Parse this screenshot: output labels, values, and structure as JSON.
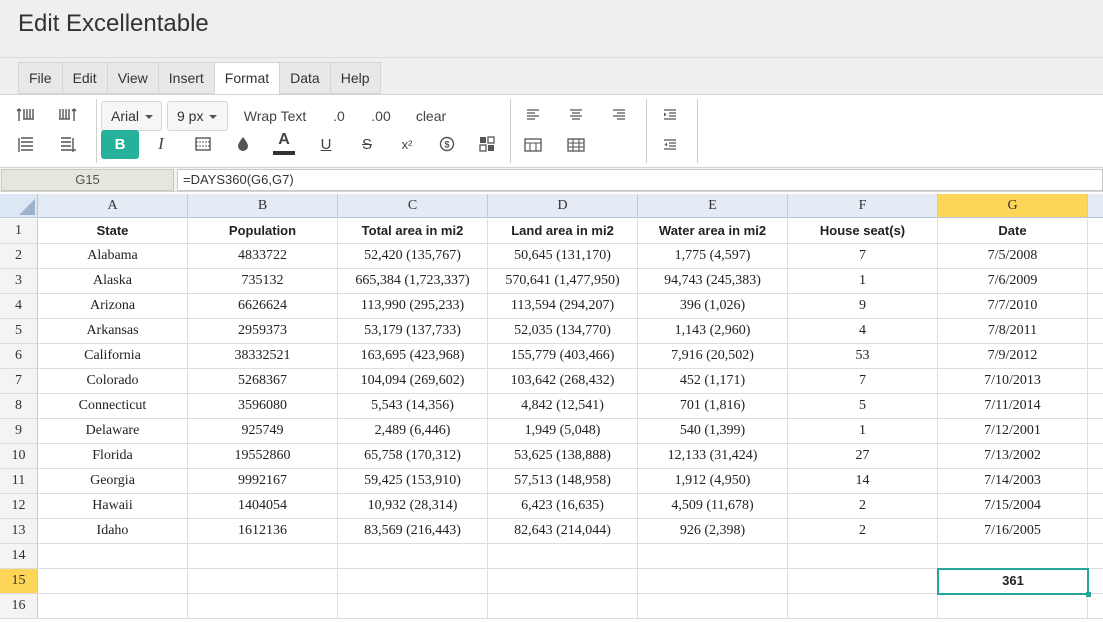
{
  "app": {
    "title": "Edit Excellentable"
  },
  "menu": {
    "tabs": [
      "File",
      "Edit",
      "View",
      "Insert",
      "Format",
      "Data",
      "Help"
    ],
    "active": "Format"
  },
  "toolbar": {
    "font_family": "Arial",
    "font_size": "9 px",
    "wrap_text": "Wrap Text",
    "decimal_decrease": ".0",
    "decimal_increase": ".00",
    "clear": "clear",
    "bold": "B",
    "italic": "I",
    "underline": "U",
    "strike": "S",
    "superscript": "x²",
    "text_color_letter": "A",
    "currency": "$",
    "accent_color": "#26b19a",
    "text_color_bar": "#333333"
  },
  "formula_bar": {
    "cell_ref": "G15",
    "formula": "=DAYS360(G6,G7)"
  },
  "sheet": {
    "columns": [
      "A",
      "B",
      "C",
      "D",
      "E",
      "F",
      "G"
    ],
    "selected_column": "G",
    "selected_row": "15",
    "row_numbers": [
      "1",
      "2",
      "3",
      "4",
      "5",
      "6",
      "7",
      "8",
      "9",
      "10",
      "11",
      "12",
      "13",
      "14",
      "15",
      "16"
    ],
    "header": [
      "State",
      "Population",
      "Total area in mi2",
      "Land area in mi2",
      "Water area in mi2",
      "House seat(s)",
      "Date"
    ],
    "rows": [
      [
        "Alabama",
        "4833722",
        "52,420 (135,767)",
        "50,645 (131,170)",
        "1,775 (4,597)",
        "7",
        "7/5/2008"
      ],
      [
        "Alaska",
        "735132",
        "665,384 (1,723,337)",
        "570,641 (1,477,950)",
        "94,743 (245,383)",
        "1",
        "7/6/2009"
      ],
      [
        "Arizona",
        "6626624",
        "113,990 (295,233)",
        "113,594 (294,207)",
        "396 (1,026)",
        "9",
        "7/7/2010"
      ],
      [
        "Arkansas",
        "2959373",
        "53,179 (137,733)",
        "52,035 (134,770)",
        "1,143 (2,960)",
        "4",
        "7/8/2011"
      ],
      [
        "California",
        "38332521",
        "163,695 (423,968)",
        "155,779 (403,466)",
        "7,916 (20,502)",
        "53",
        "7/9/2012"
      ],
      [
        "Colorado",
        "5268367",
        "104,094 (269,602)",
        "103,642 (268,432)",
        "452 (1,171)",
        "7",
        "7/10/2013"
      ],
      [
        "Connecticut",
        "3596080",
        "5,543 (14,356)",
        "4,842 (12,541)",
        "701 (1,816)",
        "5",
        "7/11/2014"
      ],
      [
        "Delaware",
        "925749",
        "2,489 (6,446)",
        "1,949 (5,048)",
        "540 (1,399)",
        "1",
        "7/12/2001"
      ],
      [
        "Florida",
        "19552860",
        "65,758 (170,312)",
        "53,625 (138,888)",
        "12,133 (31,424)",
        "27",
        "7/13/2002"
      ],
      [
        "Georgia",
        "9992167",
        "59,425 (153,910)",
        "57,513 (148,958)",
        "1,912 (4,950)",
        "14",
        "7/14/2003"
      ],
      [
        "Hawaii",
        "1404054",
        "10,932 (28,314)",
        "6,423 (16,635)",
        "4,509 (11,678)",
        "2",
        "7/15/2004"
      ],
      [
        "Idaho",
        "1612136",
        "83,569 (216,443)",
        "82,643 (214,044)",
        "926 (2,398)",
        "2",
        "7/16/2005"
      ]
    ],
    "result_cell_value": "361",
    "selection_color": "#26a69a",
    "highlight_color": "#fdd659"
  }
}
